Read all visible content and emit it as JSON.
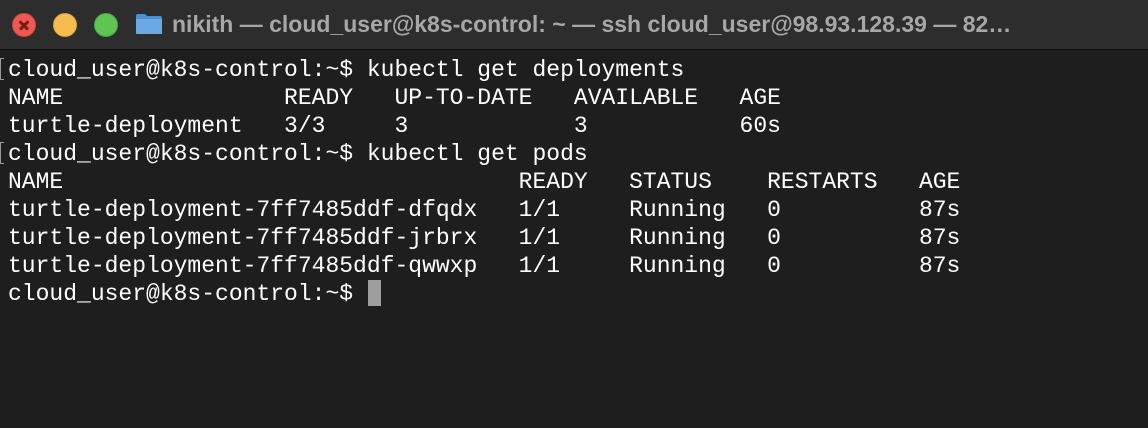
{
  "window": {
    "title": "nikith — cloud_user@k8s-control: ~ — ssh cloud_user@98.93.128.39 — 82…"
  },
  "colors": {
    "close": "#ee5a52",
    "minimize": "#f5bd4f",
    "zoom": "#5fc454",
    "terminal_bg": "#1e1e1e",
    "text": "#ffffff"
  },
  "terminal": {
    "lines": [
      "cloud_user@k8s-control:~$ kubectl get deployments",
      "NAME                READY   UP-TO-DATE   AVAILABLE   AGE",
      "turtle-deployment   3/3     3            3           60s",
      "cloud_user@k8s-control:~$ kubectl get pods",
      "NAME                                 READY   STATUS    RESTARTS   AGE",
      "turtle-deployment-7ff7485ddf-dfqdx   1/1     Running   0          87s",
      "turtle-deployment-7ff7485ddf-jrbrx   1/1     Running   0          87s",
      "turtle-deployment-7ff7485ddf-qwwxp   1/1     Running   0          87s",
      "cloud_user@k8s-control:~$ "
    ]
  }
}
